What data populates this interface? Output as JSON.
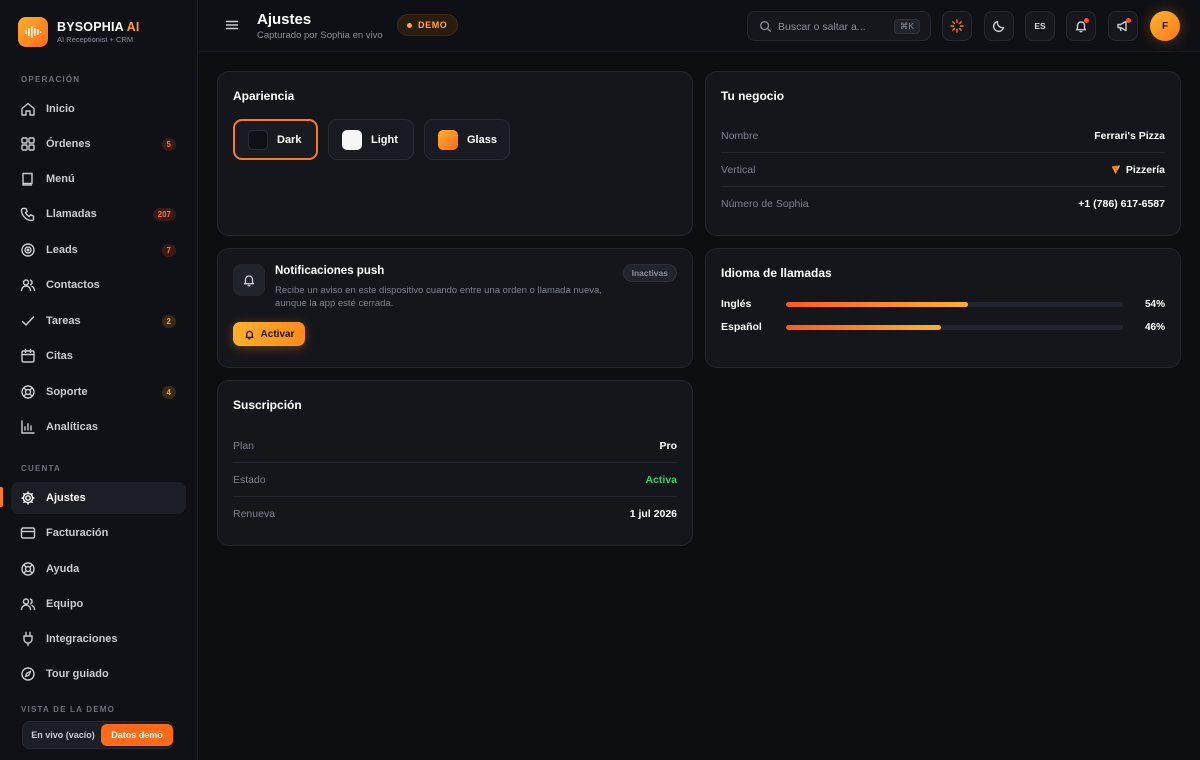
{
  "brand": {
    "name_main": "BYSOPHIA",
    "name_accent": "AI",
    "subtitle": "AI Receptionist + CRM"
  },
  "sidebar": {
    "section_operacion": "OPERACIÓN",
    "section_cuenta": "CUENTA",
    "section_demo": "VISTA DE LA DEMO",
    "operacion_items": [
      {
        "label": "Inicio",
        "icon": "home-icon"
      },
      {
        "label": "Órdenes",
        "icon": "grid-icon",
        "badge": "5"
      },
      {
        "label": "Menú",
        "icon": "book-icon"
      },
      {
        "label": "Llamadas",
        "icon": "phone-icon",
        "badge": "207"
      },
      {
        "label": "Leads",
        "icon": "target-icon",
        "badge": "7"
      },
      {
        "label": "Contactos",
        "icon": "users-icon"
      },
      {
        "label": "Tareas",
        "icon": "check-icon",
        "badge": "2"
      },
      {
        "label": "Citas",
        "icon": "calendar-icon"
      },
      {
        "label": "Soporte",
        "icon": "lifebuoy-icon",
        "badge": "4"
      },
      {
        "label": "Analíticas",
        "icon": "chart-icon"
      }
    ],
    "cuenta_items": [
      {
        "label": "Ajustes",
        "icon": "gear-icon",
        "active": true
      },
      {
        "label": "Facturación",
        "icon": "card-icon"
      },
      {
        "label": "Ayuda",
        "icon": "help-icon"
      },
      {
        "label": "Equipo",
        "icon": "team-icon"
      },
      {
        "label": "Integraciones",
        "icon": "plug-icon"
      },
      {
        "label": "Tour guiado",
        "icon": "compass-icon"
      }
    ],
    "demo_toggle": {
      "off_label": "En vivo (vacío)",
      "on_label": "Datos demo",
      "selected": "Datos demo"
    }
  },
  "header": {
    "title": "Ajustes",
    "subtitle": "Capturado por Sophia en vivo",
    "demo_badge": "DEMO",
    "search_placeholder": "Buscar o saltar a...",
    "search_shortcut": "⌘K",
    "language": "ES",
    "avatar_initial": "F",
    "notification_dot_color": "#ff4d3a"
  },
  "appearance": {
    "title": "Apariencia",
    "options": [
      {
        "label": "Dark",
        "selected": true
      },
      {
        "label": "Light",
        "selected": false
      },
      {
        "label": "Glass",
        "selected": false
      }
    ]
  },
  "business": {
    "title": "Tu negocio",
    "rows": [
      {
        "key": "Nombre",
        "value": "Ferrari's Pizza"
      },
      {
        "key": "Vertical",
        "value": "Pizzería",
        "icon": "pizza-icon"
      },
      {
        "key": "Número de Sophia",
        "value": "+1 (786) 617-6587"
      }
    ]
  },
  "push": {
    "title": "Notificaciones push",
    "description": "Recibe un aviso en este dispositivo cuando entre una orden o llamada nueva, aunque la app esté cerrada.",
    "status": "Inactivas",
    "button": "Activar"
  },
  "call_language": {
    "title": "Idioma de llamadas",
    "rows": [
      {
        "label": "Inglés",
        "percent": 54,
        "percent_label": "54%"
      },
      {
        "label": "Español",
        "percent": 46,
        "percent_label": "46%"
      }
    ]
  },
  "subscription": {
    "title": "Suscripción",
    "rows": [
      {
        "key": "Plan",
        "value": "Pro"
      },
      {
        "key": "Estado",
        "value": "Activa",
        "status_color": "#2fd36b"
      },
      {
        "key": "Renueva",
        "value": "1 jul 2026"
      }
    ]
  },
  "colors": {
    "accent": "#ff7a1a",
    "accent_light": "#ffb02e",
    "background": "#0d0e12",
    "card": "#15161c"
  }
}
